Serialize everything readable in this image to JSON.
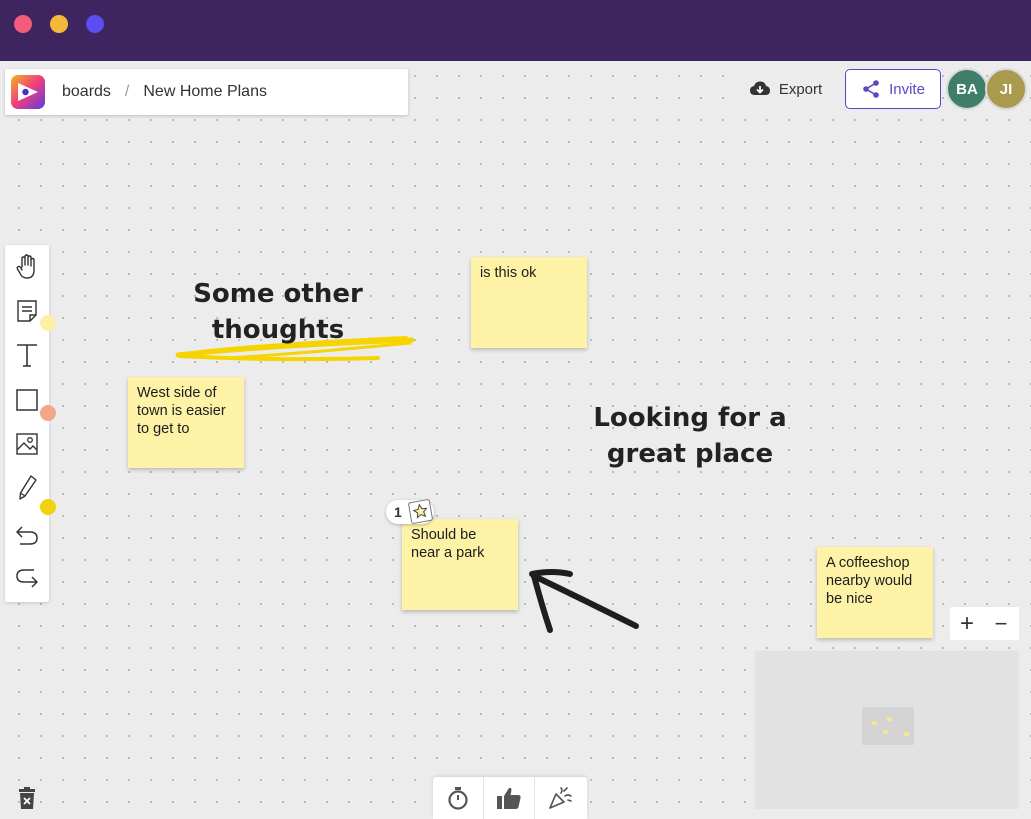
{
  "window": {
    "traffic_lights": [
      "#f25b7b",
      "#f5b93a",
      "#5b4df0"
    ],
    "titlebar_color": "#3e2560"
  },
  "breadcrumb": {
    "root": "boards",
    "separator": "/",
    "current": "New Home Plans"
  },
  "header": {
    "export_label": "Export",
    "invite_label": "Invite",
    "avatars": [
      {
        "initials": "BA",
        "color": "#3f7e6b"
      },
      {
        "initials": "JI",
        "color": "#a99a4e"
      }
    ]
  },
  "toolbar": {
    "tools": [
      "hand-icon",
      "sticky-note-icon",
      "text-icon",
      "rectangle-icon",
      "image-icon",
      "pen-icon",
      "undo-icon",
      "redo-icon"
    ],
    "badge_colors": {
      "sticky": "#fbf1a3",
      "shape": "#f6a58d",
      "pen": "#f2d20e"
    }
  },
  "board": {
    "heading_1": [
      "Some other",
      "thoughts"
    ],
    "heading_2": [
      "Looking for a",
      "great place"
    ],
    "highlight_color": "#f5d400",
    "sticky_color": "#fdf2a6",
    "stickies": [
      {
        "text": "is this ok"
      },
      {
        "text": "West side of town is easier to get to"
      },
      {
        "text": "Should be near a park"
      },
      {
        "text": "A coffeeshop nearby would be nice"
      }
    ],
    "vote": {
      "count": "1",
      "icon": "star-icon"
    }
  },
  "zoom": {
    "in_label": "+",
    "out_label": "−"
  },
  "bottom_bar": {
    "tools": [
      "timer-icon",
      "thumbs-up-icon",
      "party-popper-icon"
    ]
  }
}
